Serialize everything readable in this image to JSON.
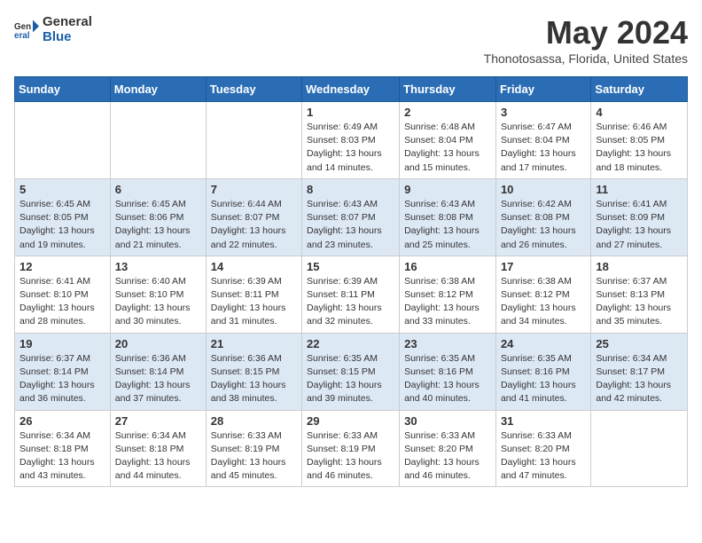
{
  "header": {
    "logo_general": "General",
    "logo_blue": "Blue",
    "month_title": "May 2024",
    "location": "Thonotosassa, Florida, United States"
  },
  "days_of_week": [
    "Sunday",
    "Monday",
    "Tuesday",
    "Wednesday",
    "Thursday",
    "Friday",
    "Saturday"
  ],
  "weeks": [
    [
      {
        "day": "",
        "info": ""
      },
      {
        "day": "",
        "info": ""
      },
      {
        "day": "",
        "info": ""
      },
      {
        "day": "1",
        "info": "Sunrise: 6:49 AM\nSunset: 8:03 PM\nDaylight: 13 hours and 14 minutes."
      },
      {
        "day": "2",
        "info": "Sunrise: 6:48 AM\nSunset: 8:04 PM\nDaylight: 13 hours and 15 minutes."
      },
      {
        "day": "3",
        "info": "Sunrise: 6:47 AM\nSunset: 8:04 PM\nDaylight: 13 hours and 17 minutes."
      },
      {
        "day": "4",
        "info": "Sunrise: 6:46 AM\nSunset: 8:05 PM\nDaylight: 13 hours and 18 minutes."
      }
    ],
    [
      {
        "day": "5",
        "info": "Sunrise: 6:45 AM\nSunset: 8:05 PM\nDaylight: 13 hours and 19 minutes."
      },
      {
        "day": "6",
        "info": "Sunrise: 6:45 AM\nSunset: 8:06 PM\nDaylight: 13 hours and 21 minutes."
      },
      {
        "day": "7",
        "info": "Sunrise: 6:44 AM\nSunset: 8:07 PM\nDaylight: 13 hours and 22 minutes."
      },
      {
        "day": "8",
        "info": "Sunrise: 6:43 AM\nSunset: 8:07 PM\nDaylight: 13 hours and 23 minutes."
      },
      {
        "day": "9",
        "info": "Sunrise: 6:43 AM\nSunset: 8:08 PM\nDaylight: 13 hours and 25 minutes."
      },
      {
        "day": "10",
        "info": "Sunrise: 6:42 AM\nSunset: 8:08 PM\nDaylight: 13 hours and 26 minutes."
      },
      {
        "day": "11",
        "info": "Sunrise: 6:41 AM\nSunset: 8:09 PM\nDaylight: 13 hours and 27 minutes."
      }
    ],
    [
      {
        "day": "12",
        "info": "Sunrise: 6:41 AM\nSunset: 8:10 PM\nDaylight: 13 hours and 28 minutes."
      },
      {
        "day": "13",
        "info": "Sunrise: 6:40 AM\nSunset: 8:10 PM\nDaylight: 13 hours and 30 minutes."
      },
      {
        "day": "14",
        "info": "Sunrise: 6:39 AM\nSunset: 8:11 PM\nDaylight: 13 hours and 31 minutes."
      },
      {
        "day": "15",
        "info": "Sunrise: 6:39 AM\nSunset: 8:11 PM\nDaylight: 13 hours and 32 minutes."
      },
      {
        "day": "16",
        "info": "Sunrise: 6:38 AM\nSunset: 8:12 PM\nDaylight: 13 hours and 33 minutes."
      },
      {
        "day": "17",
        "info": "Sunrise: 6:38 AM\nSunset: 8:12 PM\nDaylight: 13 hours and 34 minutes."
      },
      {
        "day": "18",
        "info": "Sunrise: 6:37 AM\nSunset: 8:13 PM\nDaylight: 13 hours and 35 minutes."
      }
    ],
    [
      {
        "day": "19",
        "info": "Sunrise: 6:37 AM\nSunset: 8:14 PM\nDaylight: 13 hours and 36 minutes."
      },
      {
        "day": "20",
        "info": "Sunrise: 6:36 AM\nSunset: 8:14 PM\nDaylight: 13 hours and 37 minutes."
      },
      {
        "day": "21",
        "info": "Sunrise: 6:36 AM\nSunset: 8:15 PM\nDaylight: 13 hours and 38 minutes."
      },
      {
        "day": "22",
        "info": "Sunrise: 6:35 AM\nSunset: 8:15 PM\nDaylight: 13 hours and 39 minutes."
      },
      {
        "day": "23",
        "info": "Sunrise: 6:35 AM\nSunset: 8:16 PM\nDaylight: 13 hours and 40 minutes."
      },
      {
        "day": "24",
        "info": "Sunrise: 6:35 AM\nSunset: 8:16 PM\nDaylight: 13 hours and 41 minutes."
      },
      {
        "day": "25",
        "info": "Sunrise: 6:34 AM\nSunset: 8:17 PM\nDaylight: 13 hours and 42 minutes."
      }
    ],
    [
      {
        "day": "26",
        "info": "Sunrise: 6:34 AM\nSunset: 8:18 PM\nDaylight: 13 hours and 43 minutes."
      },
      {
        "day": "27",
        "info": "Sunrise: 6:34 AM\nSunset: 8:18 PM\nDaylight: 13 hours and 44 minutes."
      },
      {
        "day": "28",
        "info": "Sunrise: 6:33 AM\nSunset: 8:19 PM\nDaylight: 13 hours and 45 minutes."
      },
      {
        "day": "29",
        "info": "Sunrise: 6:33 AM\nSunset: 8:19 PM\nDaylight: 13 hours and 46 minutes."
      },
      {
        "day": "30",
        "info": "Sunrise: 6:33 AM\nSunset: 8:20 PM\nDaylight: 13 hours and 46 minutes."
      },
      {
        "day": "31",
        "info": "Sunrise: 6:33 AM\nSunset: 8:20 PM\nDaylight: 13 hours and 47 minutes."
      },
      {
        "day": "",
        "info": ""
      }
    ]
  ]
}
